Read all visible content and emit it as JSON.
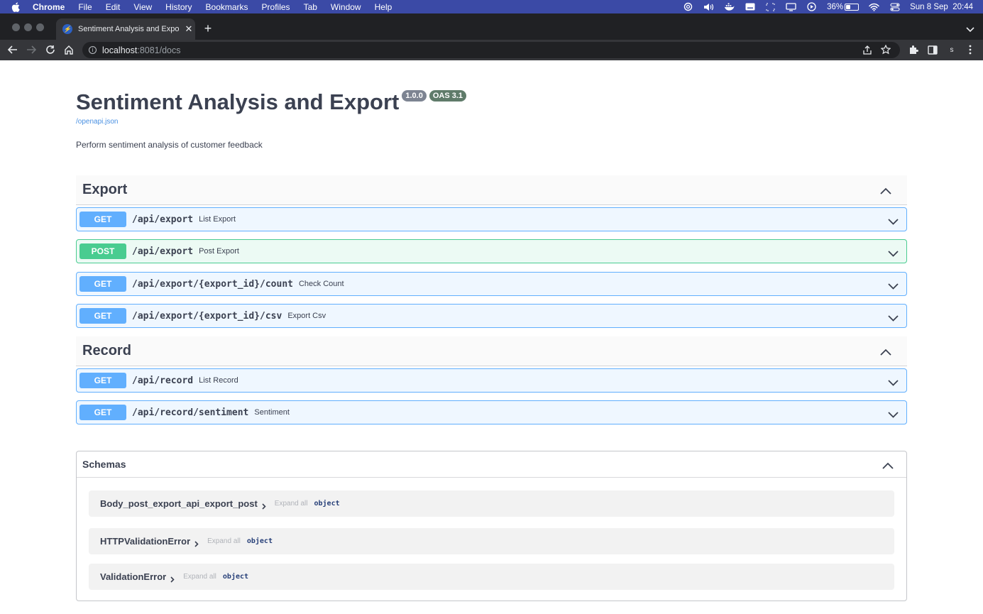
{
  "menubar": {
    "app_name": "Chrome",
    "items": [
      "File",
      "Edit",
      "View",
      "History",
      "Bookmarks",
      "Profiles",
      "Tab",
      "Window",
      "Help"
    ],
    "battery_percent": "36%",
    "battery_level": 0.36,
    "datetime": "Sun 8 Sep  20:44"
  },
  "browser": {
    "tab_title": "Sentiment Analysis and Export",
    "url_host": "localhost",
    "url_path": ":8081/docs",
    "profile_initial": "s"
  },
  "api_info": {
    "title": "Sentiment Analysis and Export",
    "version": "1.0.0",
    "oas_badge": "OAS 3.1",
    "spec_link": "/openapi.json",
    "description": "Perform sentiment analysis of customer feedback"
  },
  "tags": [
    {
      "name": "Export",
      "operations": [
        {
          "method": "GET",
          "path": "/api/export",
          "summary": "List Export"
        },
        {
          "method": "POST",
          "path": "/api/export",
          "summary": "Post Export"
        },
        {
          "method": "GET",
          "path": "/api/export/{export_id}/count",
          "summary": "Check Count"
        },
        {
          "method": "GET",
          "path": "/api/export/{export_id}/csv",
          "summary": "Export Csv"
        }
      ]
    },
    {
      "name": "Record",
      "operations": [
        {
          "method": "GET",
          "path": "/api/record",
          "summary": "List Record"
        },
        {
          "method": "GET",
          "path": "/api/record/sentiment",
          "summary": "Sentiment"
        }
      ]
    }
  ],
  "schemas": {
    "title": "Schemas",
    "items": [
      {
        "name": "Body_post_export_api_export_post",
        "expand_label": "Expand all",
        "type": "object"
      },
      {
        "name": "HTTPValidationError",
        "expand_label": "Expand all",
        "type": "object"
      },
      {
        "name": "ValidationError",
        "expand_label": "Expand all",
        "type": "object"
      }
    ]
  },
  "colors": {
    "get": "#61affe",
    "post": "#49cc90",
    "menubar": "#3b4aa6"
  }
}
